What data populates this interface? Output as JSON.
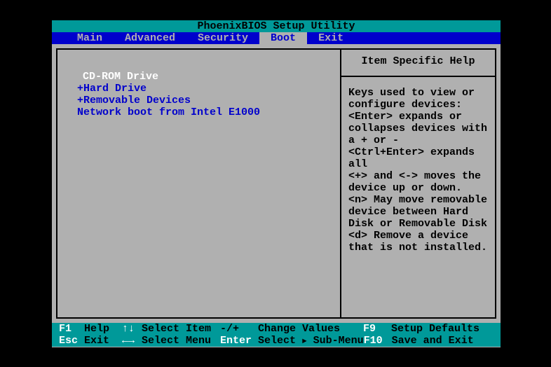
{
  "title": "PhoenixBIOS Setup Utility",
  "menu": {
    "items": [
      "Main",
      "Advanced",
      "Security",
      "Boot",
      "Exit"
    ],
    "active_index": 3
  },
  "boot": {
    "items": [
      {
        "label": "CD-ROM Drive",
        "prefix": "",
        "selected": true
      },
      {
        "label": "Hard Drive",
        "prefix": "+",
        "selected": false
      },
      {
        "label": "Removable Devices",
        "prefix": "+",
        "selected": false
      },
      {
        "label": "Network boot from Intel E1000",
        "prefix": "",
        "selected": false
      }
    ]
  },
  "help": {
    "title": "Item Specific Help",
    "body": "Keys used to view or configure devices:\n<Enter> expands or collapses devices with a + or -\n<Ctrl+Enter> expands all\n<+> and <-> moves the device up or down.\n<n> May move removable device between Hard Disk or Removable Disk\n<d> Remove a device that is not installed."
  },
  "footer": {
    "row1": {
      "k1": "F1",
      "l1": "Help",
      "a1": "↑↓",
      "act1": "Select Item",
      "k2": "-/+",
      "act2": "Change Values",
      "k3": "F9",
      "act3": "Setup Defaults"
    },
    "row2": {
      "k1": "Esc",
      "l1": "Exit",
      "a1": "←→",
      "act1": "Select Menu",
      "k2": "Enter",
      "act2a": "Select",
      "tri": "►",
      "act2b": "Sub-Menu",
      "k3": "F10",
      "act3": "Save and Exit"
    }
  }
}
